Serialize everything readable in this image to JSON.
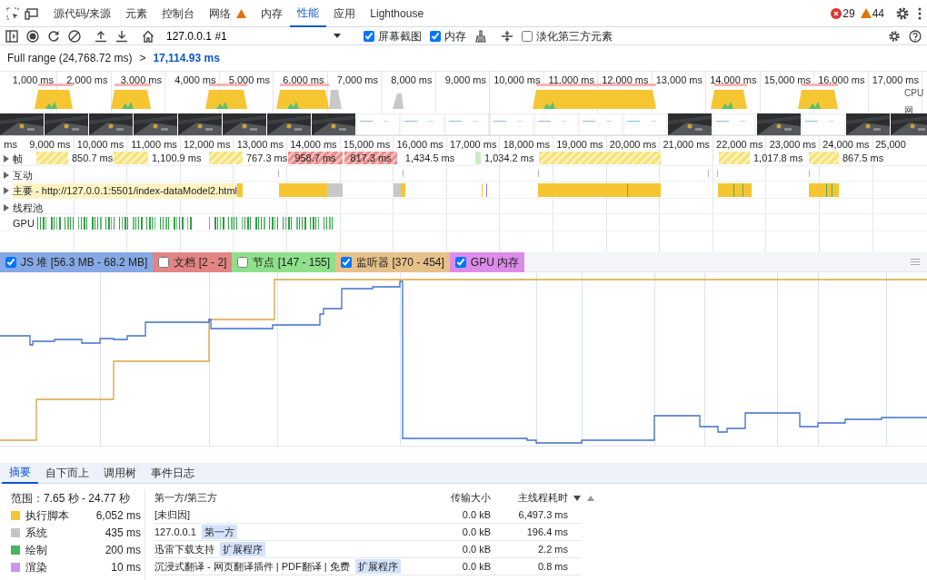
{
  "tabs": [
    {
      "label": "源代码/来源",
      "selected": false
    },
    {
      "label": "元素",
      "selected": false
    },
    {
      "label": "控制台",
      "selected": false
    },
    {
      "label": "网络",
      "selected": false,
      "warning": true
    },
    {
      "label": "内存",
      "selected": false
    },
    {
      "label": "性能",
      "selected": true
    },
    {
      "label": "应用",
      "selected": false
    },
    {
      "label": "Lighthouse",
      "selected": false
    }
  ],
  "issues": {
    "errors": "29",
    "warnings": "44"
  },
  "toolbar": {
    "target": "127.0.0.1 #1",
    "options": [
      {
        "label": "屏幕截图",
        "checked": true
      },
      {
        "label": "内存",
        "checked": true
      }
    ],
    "dim_third_party": {
      "label": "淡化第三方元素",
      "checked": false
    }
  },
  "breadcrumb": {
    "full_range": "Full range (24,768.72 ms)",
    "separator": ">",
    "selection": "17,114.93 ms"
  },
  "overview": {
    "ticks": [
      "1,000 ms",
      "2,000 ms",
      "3,000 ms",
      "4,000 ms",
      "5,000 ms",
      "6,000 ms",
      "7,000 ms",
      "8,000 ms",
      "9,000 ms",
      "10,000 ms",
      "11,000 ms",
      "12,000 ms",
      "13,000 ms",
      "14,000 ms",
      "15,000 ms",
      "16,000 ms",
      "17,000 ms"
    ],
    "lanes": [
      "CPU",
      "网"
    ]
  },
  "ruler": [
    "ms",
    "9,000 ms",
    "10,000 ms",
    "11,000 ms",
    "12,000 ms",
    "13,000 ms",
    "14,000 ms",
    "15,000 ms",
    "16,000 ms",
    "17,000 ms",
    "18,000 ms",
    "19,000 ms",
    "20,000 ms",
    "21,000 ms",
    "22,000 ms",
    "23,000 ms",
    "24,000 ms",
    "25,000"
  ],
  "tracks": [
    {
      "label": "帧",
      "expanded": false
    },
    {
      "label": "互动",
      "expanded": false
    },
    {
      "label": "主要 - http://127.0.0.1:5501/index-dataModel2.html",
      "expanded": false
    },
    {
      "label": "线程池",
      "expanded": false
    },
    {
      "label": "GPU"
    }
  ],
  "frames": [
    {
      "label": "850.7 ms",
      "kind": "partial"
    },
    {
      "label": "1,100.9 ms",
      "kind": "partial"
    },
    {
      "label": "767.3 ms",
      "kind": "partial"
    },
    {
      "label": "958.7 ms",
      "kind": "dropped"
    },
    {
      "label": "817.3 ms",
      "kind": "dropped"
    },
    {
      "label": "1,434.5 ms",
      "kind": "idle"
    },
    {
      "label": "1,034.2 ms",
      "kind": "presented"
    },
    {
      "kind": "partial"
    },
    {
      "label": "1,017.8 ms",
      "kind": "partial"
    },
    {
      "label": "867.5 ms",
      "kind": "partial"
    }
  ],
  "memory": {
    "counters": [
      {
        "label": "JS 堆 [56.3 MB - 68.2 MB]",
        "checked": true,
        "color": "#86a8e4"
      },
      {
        "label": "文档 [2 - 2]",
        "checked": false,
        "color": "#e28484"
      },
      {
        "label": "节点 [147 - 155]",
        "checked": false,
        "color": "#8ee08b"
      },
      {
        "label": "监听器 [370 - 454]",
        "checked": true,
        "color": "#e6c189"
      },
      {
        "label": "GPU 内存",
        "checked": true,
        "color": "#dc8ce8"
      }
    ]
  },
  "details": {
    "tabs": [
      {
        "label": "摘要",
        "selected": true
      },
      {
        "label": "自下而上",
        "selected": false
      },
      {
        "label": "调用树",
        "selected": false
      },
      {
        "label": "事件日志",
        "selected": false
      }
    ],
    "range": "范围：7.65 秒 - 24.77 秒",
    "categories": [
      {
        "label": "执行脚本",
        "value": "6,052 ms",
        "color": "#f5c632"
      },
      {
        "label": "系统",
        "value": "435 ms",
        "color": "#c6c6c6"
      },
      {
        "label": "绘制",
        "value": "200 ms",
        "color": "#48b45c"
      },
      {
        "label": "渲染",
        "value": "10 ms",
        "color": "#c795f2"
      }
    ],
    "table": {
      "columns": [
        "第一方/第三方",
        "传输大小",
        "主线程耗时"
      ],
      "rows": [
        {
          "entity": "[未归因]",
          "size": "0.0 kB",
          "time": "6,497.3 ms"
        },
        {
          "entity": "127.0.0.1",
          "tag": "第一方",
          "size": "0.0 kB",
          "time": "196.4 ms"
        },
        {
          "entity": "迅雷下载支持",
          "tag": "扩展程序",
          "size": "0.0 kB",
          "time": "2.2 ms"
        },
        {
          "entity": "沉浸式翻译 - 网页翻译插件 | PDF翻译 | 免费",
          "tag": "扩展程序",
          "size": "0.0 kB",
          "time": "0.8 ms"
        }
      ]
    }
  }
}
